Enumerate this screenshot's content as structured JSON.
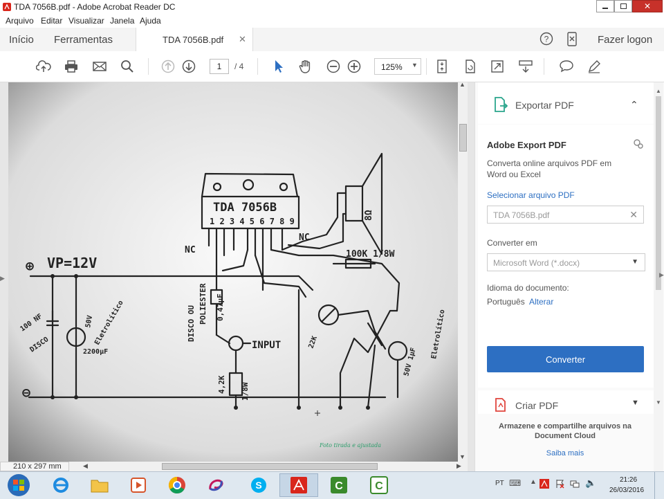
{
  "window": {
    "title": "TDA 7056B.pdf - Adobe Acrobat Reader DC"
  },
  "menu": {
    "items": [
      "Arquivo",
      "Editar",
      "Visualizar",
      "Janela",
      "Ajuda"
    ]
  },
  "nav": {
    "home": "Início",
    "tools": "Ferramentas",
    "doc_tab": "TDA 7056B.pdf",
    "login": "Fazer logon"
  },
  "toolbar": {
    "page_current": "1",
    "page_total": "/ 4",
    "zoom": "125%"
  },
  "page_size": "210 x 297 mm",
  "schematic": {
    "chip": "TDA 7056B",
    "pins": "1 2 3 4 5 6 7 8 9",
    "vp": "VP=12V",
    "plus": "⊕",
    "minus": "⊖",
    "nc_left": "NC",
    "nc_right": "NC",
    "resistor_top": "100K 1/8W",
    "polyester": "POLIESTER",
    "disco_ou": "DISCO OU",
    "cap_047": "0,47µF",
    "input": "INPUT",
    "res_42k": "4,2K",
    "res_w": "1/8W",
    "cap_100nf": "100 NF",
    "disco": "DISCO",
    "cap_50v": "50V",
    "eletrolitico": "Eletrolítico",
    "cap_2200": "2200µF",
    "pot": "22K",
    "cap_1uf": "50V 1µF",
    "eletrolitico2": "Eletrolítico",
    "speaker": "8Ω",
    "watermark": "Foto tirada e ajustada"
  },
  "panel": {
    "export_title": "Exportar PDF",
    "card_title": "Adobe Export PDF",
    "card_desc": "Converta online arquivos PDF em Word ou Excel",
    "select_link": "Selecionar arquivo PDF",
    "file_value": "TDA 7056B.pdf",
    "convert_to_label": "Converter em",
    "convert_to_value": "Microsoft Word (*.docx)",
    "lang_label": "Idioma do documento:",
    "lang_value": "Português",
    "lang_change": "Alterar",
    "convert_button": "Converter",
    "create_pdf": "Criar PDF",
    "cloud_text": "Armazene e compartilhe arquivos na Document Cloud",
    "learn_more": "Saiba mais"
  },
  "taskbar": {
    "lang": "PT",
    "time": "21:26",
    "date": "26/03/2016"
  },
  "colors": {
    "accent_blue": "#2d6fc2",
    "export_green": "#2aa58c",
    "create_red": "#e0443c"
  }
}
